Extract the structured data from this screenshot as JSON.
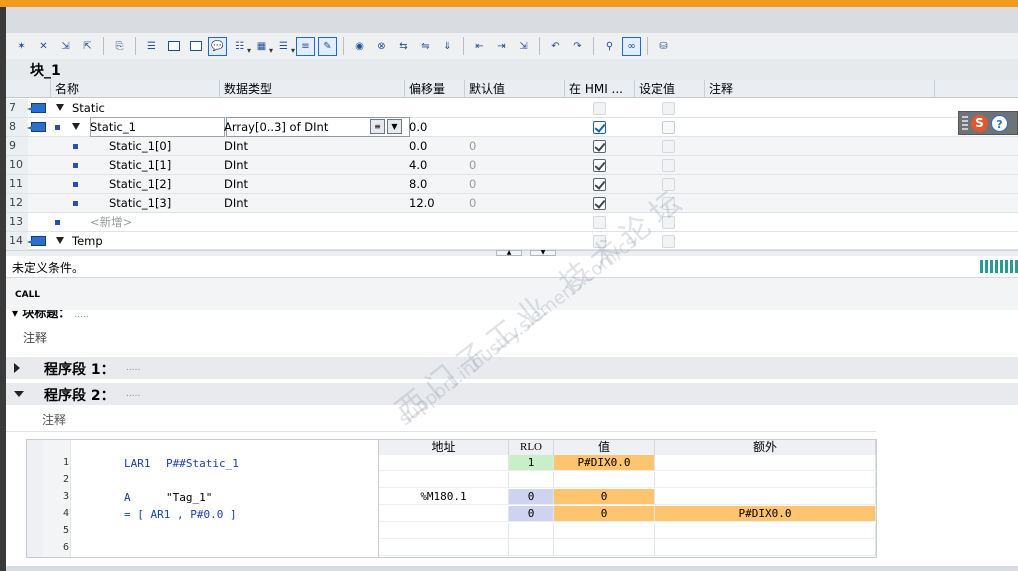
{
  "block": {
    "title": "块_1"
  },
  "columns": [
    "名称",
    "数据类型",
    "偏移量",
    "默认值",
    "在 HMI ...",
    "设定值",
    "注释"
  ],
  "rows": [
    {
      "num": "7",
      "name": "Static",
      "type": "",
      "offset": "",
      "default": ""
    },
    {
      "num": "8",
      "name": "Static_1",
      "type": "Array[0..3] of DInt",
      "offset": "0.0",
      "default": ""
    },
    {
      "num": "9",
      "name": "Static_1[0]",
      "type": "DInt",
      "offset": "0.0",
      "default": "0"
    },
    {
      "num": "10",
      "name": "Static_1[1]",
      "type": "DInt",
      "offset": "4.0",
      "default": "0"
    },
    {
      "num": "11",
      "name": "Static_1[2]",
      "type": "DInt",
      "offset": "8.0",
      "default": "0"
    },
    {
      "num": "12",
      "name": "Static_1[3]",
      "type": "DInt",
      "offset": "12.0",
      "default": "0"
    },
    {
      "num": "13",
      "name": "<新增>",
      "type": "",
      "offset": "",
      "default": ""
    },
    {
      "num": "14",
      "name": "Temp",
      "type": "",
      "offset": "",
      "default": ""
    }
  ],
  "status_message": "未定义条件。",
  "call_label": "CALL",
  "block_title": {
    "label": "块标题：",
    "dots": ".....",
    "comment": "注释"
  },
  "networks": [
    {
      "label": "程序段 1：",
      "dots": "....."
    },
    {
      "label": "程序段 2：",
      "dots": ".....",
      "comment": "注释"
    }
  ],
  "stl": {
    "headers": {
      "address": "地址",
      "rlo": "RLO",
      "value": "值",
      "extra": "额外"
    },
    "lines": [
      {
        "n": "1",
        "code_kw": "LAR1",
        "code_arg": "P##Static_1",
        "address": "",
        "rlo": "1",
        "value": "P#DIX0.0",
        "extra": ""
      },
      {
        "n": "2",
        "code_kw": "",
        "code_arg": "",
        "address": "",
        "rlo": "",
        "value": "",
        "extra": ""
      },
      {
        "n": "3",
        "code_kw": "A",
        "code_arg": "\"Tag_1\"",
        "address": "%M180.1",
        "rlo": "0",
        "value": "0",
        "extra": ""
      },
      {
        "n": "4",
        "code_kw": "= [ AR1 , P#0.0 ]",
        "code_arg": "",
        "address": "",
        "rlo": "0",
        "value": "0",
        "extra": "P#DIX0.0"
      },
      {
        "n": "5",
        "code_kw": "",
        "code_arg": "",
        "address": "",
        "rlo": "",
        "value": "",
        "extra": ""
      },
      {
        "n": "6",
        "code_kw": "",
        "code_arg": "",
        "address": "",
        "rlo": "",
        "value": "",
        "extra": ""
      }
    ]
  },
  "watermark": {
    "line1": "西门子工业 技术论坛",
    "line2": "support.industry.siemens.com/cs"
  },
  "colors": {
    "accent_orange": "#f39a1e",
    "rlo_green": "#c8efc8",
    "value_orange": "#ffc46d",
    "rlo_lavender": "#cfd3ef"
  }
}
